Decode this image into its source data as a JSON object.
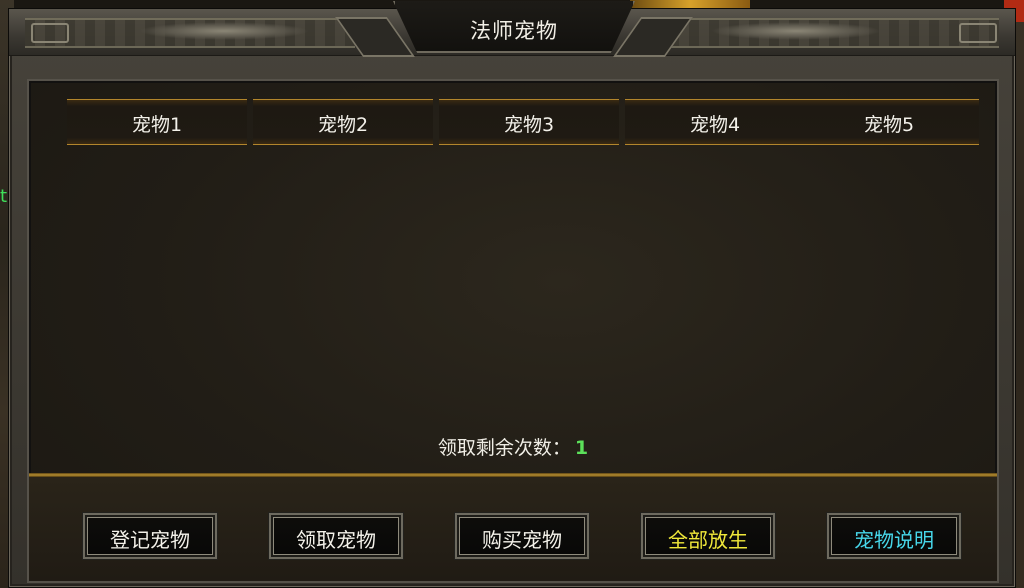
{
  "window": {
    "title": "法师宠物"
  },
  "tabs": [
    {
      "label": "宠物1"
    },
    {
      "label": "宠物2"
    },
    {
      "label": "宠物3"
    },
    {
      "label": "宠物4"
    },
    {
      "label": "宠物5"
    }
  ],
  "remaining": {
    "label": "领取剩余次数：",
    "count": "1",
    "count_color": "#5ce05a"
  },
  "buttons": [
    {
      "label": "登记宠物",
      "color": "#f4f2ea"
    },
    {
      "label": "领取宠物",
      "color": "#f4f2ea"
    },
    {
      "label": "购买宠物",
      "color": "#f4f2ea"
    },
    {
      "label": "全部放生",
      "color": "#f0e83a"
    },
    {
      "label": "宠物说明",
      "color": "#47d7ea"
    }
  ]
}
